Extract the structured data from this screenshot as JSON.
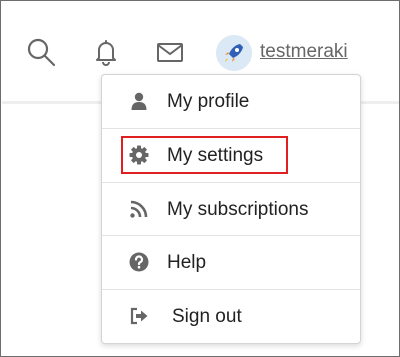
{
  "header": {
    "username": "testmeraki",
    "icons": [
      "search-icon",
      "bell-icon",
      "mail-icon",
      "avatar-rocket-icon"
    ]
  },
  "menu": {
    "items": [
      {
        "label": "My profile",
        "icon": "user-icon"
      },
      {
        "label": "My settings",
        "icon": "gear-icon"
      },
      {
        "label": "My subscriptions",
        "icon": "rss-icon"
      },
      {
        "label": "Help",
        "icon": "question-circle-icon"
      },
      {
        "label": "Sign out",
        "icon": "sign-out-icon"
      }
    ]
  },
  "colors": {
    "highlight": "#e02020",
    "icon_gray": "#666666"
  }
}
